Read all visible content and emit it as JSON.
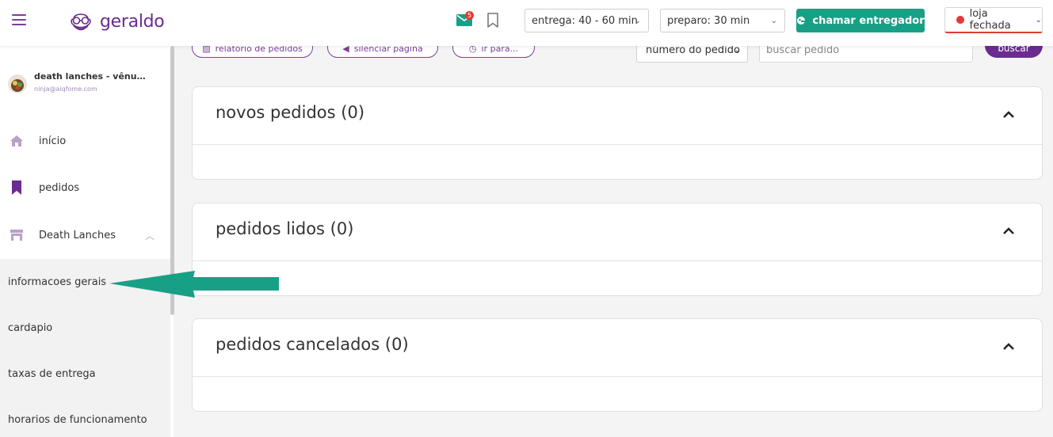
{
  "header": {
    "logo_text": "geraldo",
    "mail_badge": "5",
    "entrega_select": "entrega: 40 - 60 min",
    "preparo_select": "preparo: 30 min",
    "chamar_button": "chamar entregador",
    "loja_status": "loja fechada",
    "status_color": "#e53935",
    "accent_green": "#18a087",
    "brand_purple": "#6a2c8f"
  },
  "sidebar": {
    "user_name": "death lanches - vênus - ni...",
    "user_email": "ninja@aiqfome.com",
    "items": [
      {
        "label": "início",
        "icon": "home-icon"
      },
      {
        "label": "pedidos",
        "icon": "bookmark-icon"
      },
      {
        "label": "Death Lanches",
        "icon": "store-icon"
      }
    ],
    "subitems": [
      {
        "label": "informacoes gerais"
      },
      {
        "label": "cardapio"
      },
      {
        "label": "taxas de entrega"
      },
      {
        "label": "horarios de funcionamento"
      }
    ]
  },
  "toolbar": {
    "relatorio": "relatório de pedidos",
    "silenciar": "silenciar página",
    "ir_para": "ir para...",
    "search_type": "número do pedido",
    "search_placeholder": "buscar pedido",
    "buscar_button": "buscar"
  },
  "panels": [
    {
      "title": "novos pedidos (0)"
    },
    {
      "title": "pedidos lidos (0)"
    },
    {
      "title": "pedidos cancelados (0)"
    }
  ]
}
